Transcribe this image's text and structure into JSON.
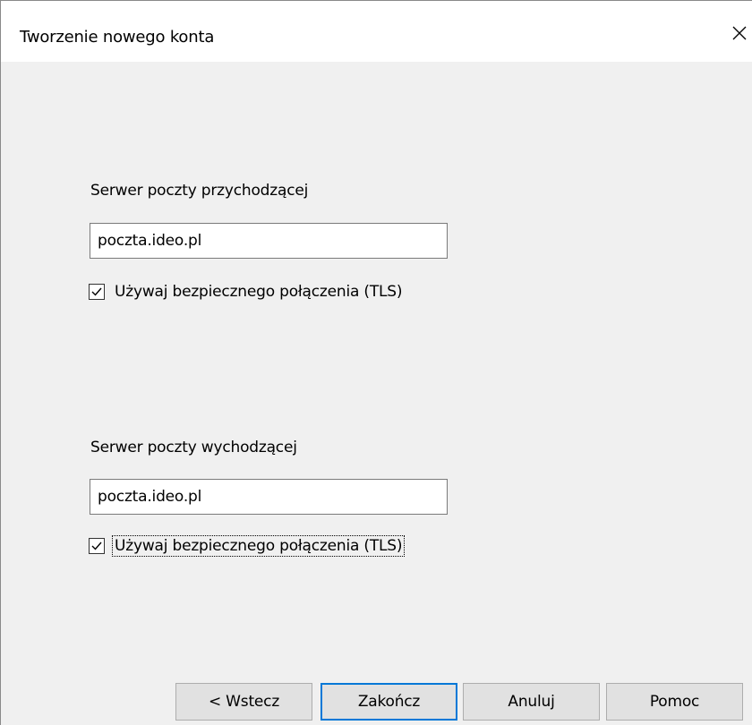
{
  "window": {
    "title": "Tworzenie nowego konta"
  },
  "incoming": {
    "label": "Serwer poczty przychodzącej",
    "value": "poczta.ideo.pl",
    "tls_label": "Używaj bezpiecznego połączenia (TLS)",
    "tls_checked": true
  },
  "outgoing": {
    "label": "Serwer poczty wychodzącej",
    "value": "poczta.ideo.pl",
    "tls_label": "Używaj bezpiecznego połączenia (TLS)",
    "tls_checked": true
  },
  "buttons": {
    "back": "< Wstecz",
    "finish": "Zakończ",
    "cancel": "Anuluj",
    "help": "Pomoc"
  },
  "colors": {
    "accent": "#0078d7",
    "background": "#f0f0f0"
  }
}
